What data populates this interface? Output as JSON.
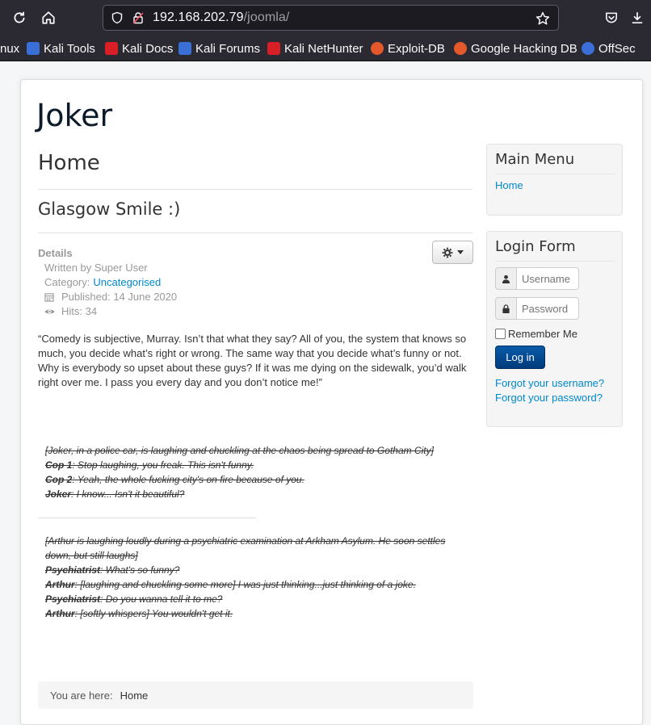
{
  "browser": {
    "url_host": "192.168.202.79",
    "url_path": "/joomla/",
    "bookmarks": [
      {
        "label": "nux",
        "color": ""
      },
      {
        "label": "Kali Tools",
        "color": "#3a6fd8"
      },
      {
        "label": "Kali Docs",
        "color": "#d81f26"
      },
      {
        "label": "Kali Forums",
        "color": "#3a6fd8"
      },
      {
        "label": "Kali NetHunter",
        "color": "#d81f26"
      },
      {
        "label": "Exploit-DB",
        "color": "#e5582b"
      },
      {
        "label": "Google Hacking DB",
        "color": "#e5582b"
      },
      {
        "label": "OffSec",
        "color": "#3a6fd8"
      }
    ]
  },
  "site": {
    "brand": "Joker",
    "page_heading": "Home",
    "article_title": "Glasgow Smile :)"
  },
  "article": {
    "details_label": "Details",
    "written_by": "Written by Super User",
    "category_prefix": "Category:",
    "category": "Uncategorised",
    "published": "Published: 14 June 2020",
    "hits": "Hits: 34",
    "quote": "“Comedy is subjective, Murray. Isn’t that what they say? All of you, the system that knows so much, you decide what’s right or wrong. The same way that you decide what’s funny or not. Why is everybody so upset about these guys? If it was me dying on the sidewalk, you’d walk right over me. I pass you every day and you don’t notice me!”",
    "dialog1": {
      "scene": "[Joker, in a police car, is laughing and chuckling at the chaos being spread to Gotham City]",
      "lines": [
        {
          "speaker": "Cop 1",
          "text": ": Stop laughing, you freak. This isn't funny."
        },
        {
          "speaker": "Cop 2",
          "text": ": Yeah, the whole fucking city's on fire because of you."
        },
        {
          "speaker": "Joker",
          "text": ": I know... Isn't it beautiful?"
        }
      ]
    },
    "dialog2": {
      "scene": "[Arthur is laughing loudly during a psychiatric examination at Arkham Asylum. He soon settles down, but still laughs]",
      "lines": [
        {
          "speaker": "Psychiatrist",
          "text": ": What's so funny?"
        },
        {
          "speaker": "Arthur",
          "text": ": [laughing and chuckling some more] I was just thinking...just thinking of a joke."
        },
        {
          "speaker": "Psychiatrist",
          "text": ": Do you wanna tell it to me?"
        },
        {
          "speaker": "Arthur",
          "text": ": [softly whispers] You wouldn't get it."
        }
      ]
    }
  },
  "breadcrumb": {
    "prefix": "You are here:",
    "current": "Home"
  },
  "sidebar": {
    "main_menu_title": "Main Menu",
    "main_menu_items": [
      "Home"
    ],
    "login_title": "Login Form",
    "username_placeholder": "Username",
    "password_placeholder": "Password",
    "remember_label": "Remember Me",
    "login_button": "Log in",
    "forgot_username": "Forgot your username?",
    "forgot_password": "Forgot your password?"
  },
  "colors": {
    "link": "#0088cc",
    "login_button": "#0a4f99",
    "chrome": "#2b2a33"
  }
}
